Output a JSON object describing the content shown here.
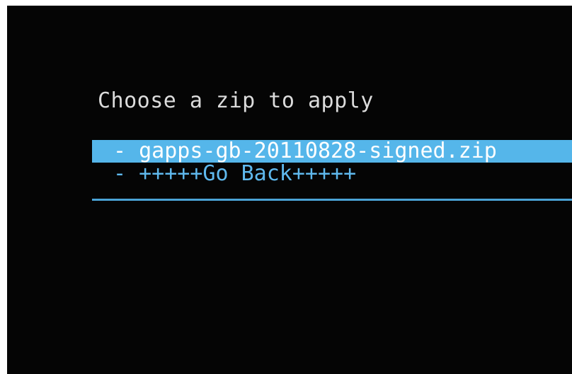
{
  "screen": {
    "title": "Choose a zip to apply"
  },
  "menu": {
    "items": [
      {
        "label": "- gapps-gb-20110828-signed.zip"
      },
      {
        "label": "- +++++Go Back+++++"
      }
    ]
  },
  "colors": {
    "background": "#050505",
    "highlight": "#55b6ea",
    "accent_text": "#5fb9ee",
    "title_text": "#dcdcdc"
  }
}
